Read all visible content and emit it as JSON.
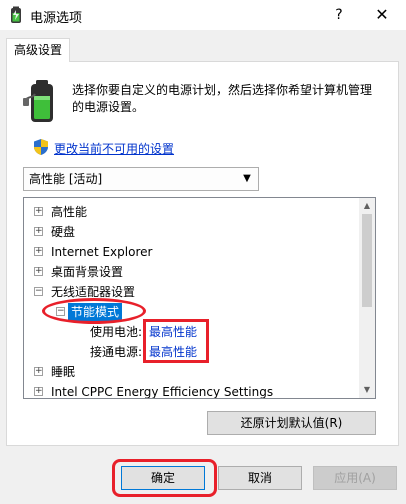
{
  "window": {
    "title": "电源选项",
    "help": "?",
    "close": "✕"
  },
  "tab": {
    "label": "高级设置"
  },
  "description": "选择你要自定义的电源计划，然后选择你希望计算机管理的电源设置。",
  "link_text": "更改当前不可用的设置",
  "plan_select": {
    "value": "高性能 [活动]"
  },
  "tree": {
    "rows": [
      {
        "expander": "+",
        "label": "高性能"
      },
      {
        "expander": "+",
        "label": "硬盘"
      },
      {
        "expander": "+",
        "label": "Internet Explorer"
      },
      {
        "expander": "+",
        "label": "桌面背景设置"
      },
      {
        "expander": "−",
        "label": "无线适配器设置"
      },
      {
        "expander": "−",
        "label": "节能模式"
      },
      {
        "label": "使用电池:",
        "value": "最高性能"
      },
      {
        "label": "接通电源:",
        "value": "最高性能"
      },
      {
        "expander": "+",
        "label": "睡眠"
      },
      {
        "expander": "+",
        "label": "Intel CPPC Energy Efficiency Settings"
      }
    ]
  },
  "buttons": {
    "restore": "还原计划默认值(R)",
    "ok": "确定",
    "cancel": "取消",
    "apply": "应用(A)"
  },
  "colors": {
    "accent": "#0078d7",
    "link": "#0033cc",
    "annotation_red": "#e8202a"
  }
}
